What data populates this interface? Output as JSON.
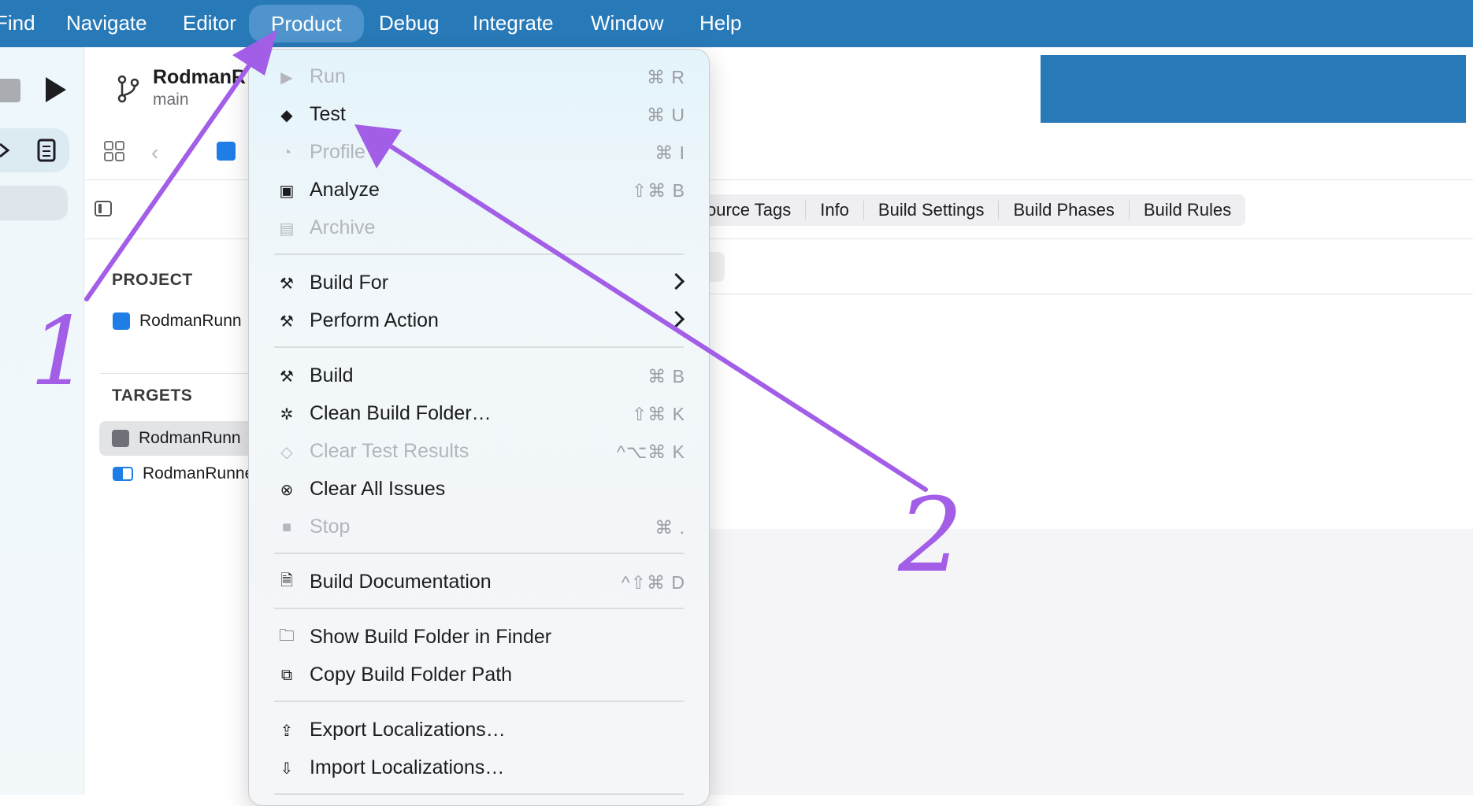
{
  "menubar": {
    "items": [
      {
        "label": "Find",
        "left": 0
      },
      {
        "label": "Navigate"
      },
      {
        "label": "Editor"
      },
      {
        "label": "Product"
      },
      {
        "label": "Debug"
      },
      {
        "label": "Integrate"
      },
      {
        "label": "Window"
      },
      {
        "label": "Help"
      }
    ],
    "active": "Product"
  },
  "toolbar": {
    "project_name": "RodmanR",
    "branch": "main"
  },
  "tabs": [
    "ource Tags",
    "Info",
    "Build Settings",
    "Build Phases",
    "Build Rules"
  ],
  "navigator": {
    "project_header": "PROJECT",
    "project_item": "RodmanRunn",
    "targets_header": "TARGETS",
    "targets": [
      "RodmanRunn",
      "RodmanRunne"
    ]
  },
  "menu": {
    "items": [
      {
        "label": "Run",
        "shortcut": "⌘ R",
        "icon": "play-icon",
        "glyph": "▶",
        "disabled": true
      },
      {
        "label": "Test",
        "shortcut": "⌘ U",
        "icon": "test-diamond-icon",
        "glyph": "◆",
        "disabled": false
      },
      {
        "label": "Profile",
        "shortcut": "⌘ I",
        "icon": "profile-gauge-icon",
        "glyph": "◔",
        "disabled": true
      },
      {
        "label": "Analyze",
        "shortcut": "⇧⌘ B",
        "icon": "analyze-icon",
        "glyph": "▣",
        "disabled": false
      },
      {
        "label": "Archive",
        "shortcut": "",
        "icon": "archive-icon",
        "glyph": "▤",
        "disabled": true
      },
      {
        "label": "Build For",
        "shortcut": "",
        "icon": "hammer-icon",
        "glyph": "⚒",
        "disabled": false,
        "submenu": true
      },
      {
        "label": "Perform Action",
        "shortcut": "",
        "icon": "hammer-gear-icon",
        "glyph": "⚒",
        "disabled": false,
        "submenu": true
      },
      {
        "label": "Build",
        "shortcut": "⌘ B",
        "icon": "hammer-icon",
        "glyph": "⚒",
        "disabled": false
      },
      {
        "label": "Clean Build Folder…",
        "shortcut": "⇧⌘ K",
        "icon": "clean-sparkle-icon",
        "glyph": "✲",
        "disabled": false
      },
      {
        "label": "Clear Test Results",
        "shortcut": "^⌥⌘ K",
        "icon": "clear-test-icon",
        "glyph": "◇",
        "disabled": true
      },
      {
        "label": "Clear All Issues",
        "shortcut": "",
        "icon": "clear-issues-icon",
        "glyph": "⊗",
        "disabled": false
      },
      {
        "label": "Stop",
        "shortcut": "⌘ .",
        "icon": "stop-icon",
        "glyph": "■",
        "disabled": true
      },
      {
        "label": "Build Documentation",
        "shortcut": "^⇧⌘ D",
        "icon": "document-icon",
        "glyph": "🗎",
        "disabled": false
      },
      {
        "label": "Show Build Folder in Finder",
        "shortcut": "",
        "icon": "folder-icon",
        "glyph": "🗀",
        "disabled": false
      },
      {
        "label": "Copy Build Folder Path",
        "shortcut": "",
        "icon": "copy-icon",
        "glyph": "⧉",
        "disabled": false
      },
      {
        "label": "Export Localizations…",
        "shortcut": "",
        "icon": "export-icon",
        "glyph": "⇪",
        "disabled": false
      },
      {
        "label": "Import Localizations…",
        "shortcut": "",
        "icon": "import-icon",
        "glyph": "⇩",
        "disabled": false
      }
    ]
  },
  "annotations": {
    "label_1": "1",
    "label_2": "2",
    "color": "#a35ee8"
  }
}
